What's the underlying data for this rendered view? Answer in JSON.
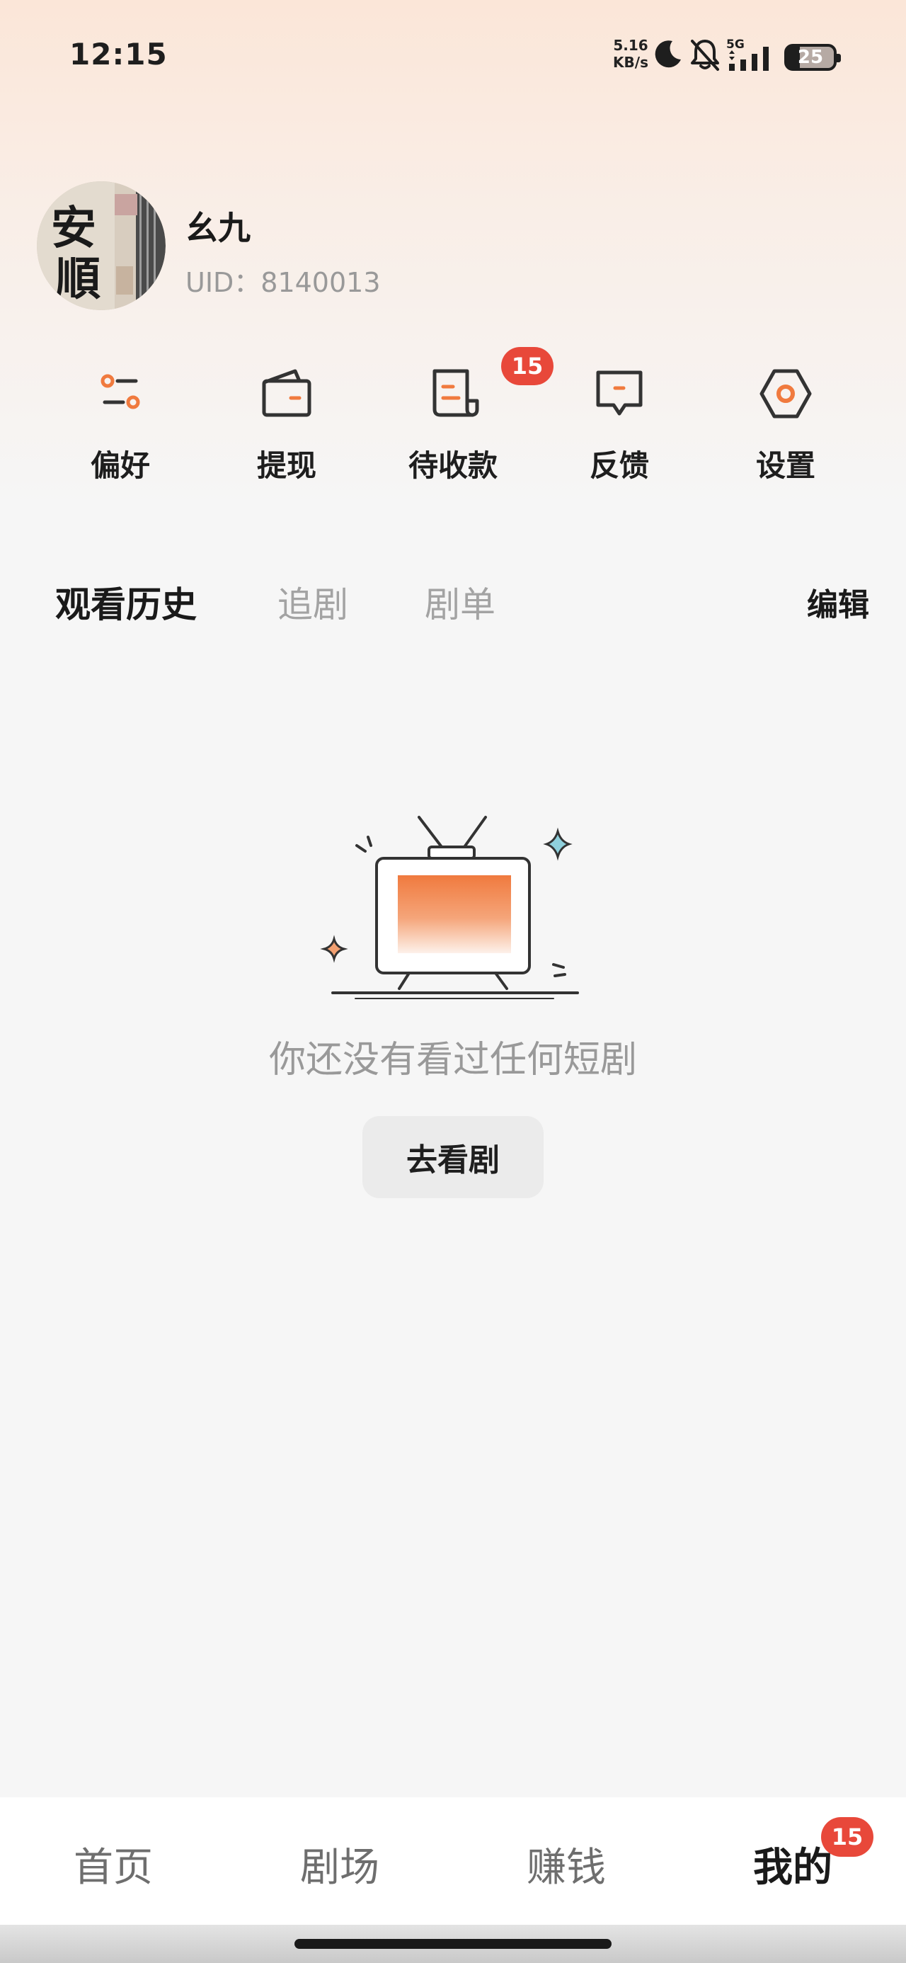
{
  "status_bar": {
    "time": "12:15",
    "net_speed_value": "5.16",
    "net_speed_unit": "KB/s",
    "network": "5G",
    "battery": "25",
    "icons": [
      "moon-icon",
      "bell-off-icon",
      "signal-5g-icon",
      "battery-icon"
    ]
  },
  "profile": {
    "name": "幺九",
    "uid": "UID：8140013",
    "avatar_calligraphy": "安順"
  },
  "quick_menu": [
    {
      "label": "偏好",
      "icon": "preferences-sliders-icon"
    },
    {
      "label": "提现",
      "icon": "wallet-icon"
    },
    {
      "label": "待收款",
      "icon": "receipt-icon",
      "badge": "15"
    },
    {
      "label": "反馈",
      "icon": "feedback-chat-icon"
    },
    {
      "label": "设置",
      "icon": "settings-hexagon-icon"
    }
  ],
  "tabs": {
    "items": [
      "观看历史",
      "追剧",
      "剧单"
    ],
    "active": "观看历史",
    "edit_label": "编辑"
  },
  "empty_state": {
    "message": "你还没有看过任何短剧",
    "button_label": "去看剧",
    "illustration": "tv-icon"
  },
  "bottom_nav": {
    "items": [
      "首页",
      "剧场",
      "赚钱",
      "我的"
    ],
    "active": "我的",
    "badge": "15"
  },
  "colors": {
    "accent": "#f07a3e",
    "badge": "#e8483a",
    "background": "#f6f6f6"
  }
}
